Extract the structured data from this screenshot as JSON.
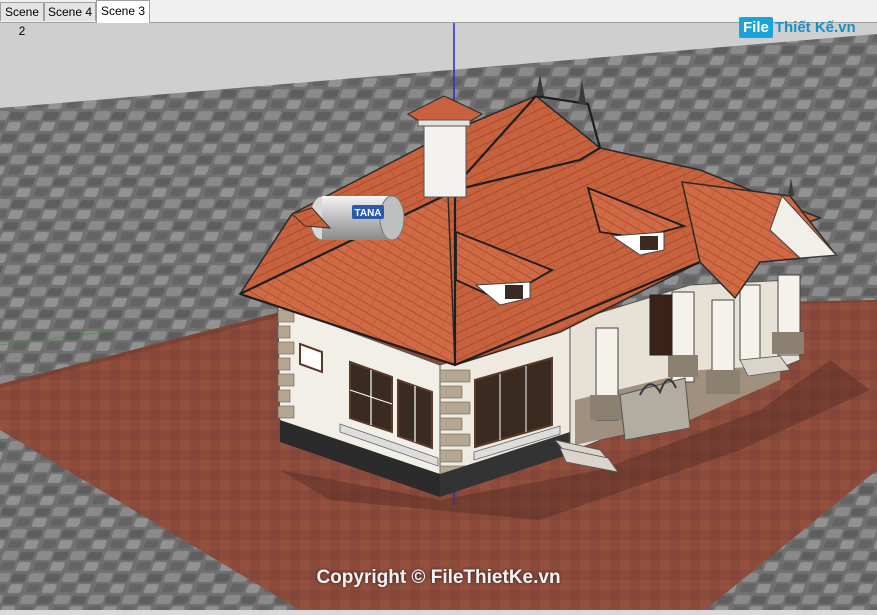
{
  "tabs": [
    {
      "label": "Scene 2",
      "active": false
    },
    {
      "label": "Scene 4",
      "active": false
    },
    {
      "label": "Scene 3",
      "active": true
    }
  ],
  "logo": {
    "box_text": "File",
    "rest_text": "Thiết Kế.vn"
  },
  "tank_label": "TANA",
  "watermark": "Copyright © FileThietKe.vn",
  "colors": {
    "roof": "#c8623e",
    "ground_tile": "#6e6e6e",
    "plot": "#8c4a3a",
    "wall": "#f2efe8",
    "axis_blue": "#1f2fd0"
  }
}
